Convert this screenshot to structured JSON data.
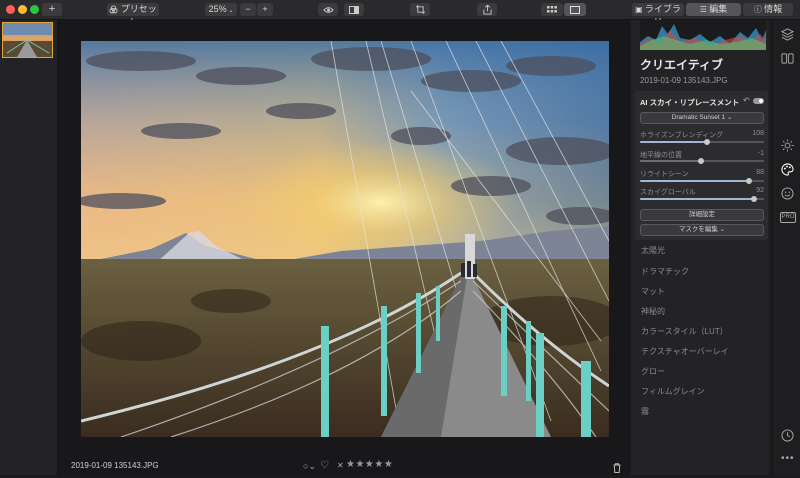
{
  "toolbar": {
    "presets_label": "プリセット",
    "zoom_value": "25%",
    "library_tab": "ライブラリ",
    "edit_tab": "編集",
    "info_tab": "情報"
  },
  "photo": {
    "filename": "2019-01-09 135143.JPG",
    "rating_stars": "★★★★★",
    "reject_label": "✕"
  },
  "panel": {
    "section_title": "クリエイティブ",
    "filename": "2019-01-09 135143.JPG",
    "tool_name": "AI スカイ・リプレースメント",
    "sky_select": "Dramatic Sunset 1",
    "sliders": [
      {
        "label": "ホライズンブレンディング",
        "value": "108",
        "level": 0.54
      },
      {
        "label": "地平線の位置",
        "value": "-1",
        "level": 0.49
      },
      {
        "label": "リライトシーン",
        "value": "88",
        "level": 0.88
      },
      {
        "label": "スカイグローバル",
        "value": "92",
        "level": 0.92
      }
    ],
    "advanced_button": "詳細設定",
    "mask_button": "マスクを編集",
    "filters": [
      "太陽光",
      "ドラマチック",
      "マット",
      "神秘的",
      "カラースタイル（LUT）",
      "テクスチャオーバーレイ",
      "グロー",
      "フィルムグレイン",
      "霧"
    ]
  },
  "colors": {
    "accent": "#e3a33b",
    "slider_fill": "#9fb7d6"
  },
  "icons": [
    "plus-icon",
    "presets-icon",
    "eye-icon",
    "compare-icon",
    "crop-icon",
    "share-icon",
    "grid-view-icon",
    "single-view-icon",
    "layers-icon",
    "sun-icon",
    "palette-icon",
    "face-icon",
    "pro-icon",
    "history-icon"
  ]
}
